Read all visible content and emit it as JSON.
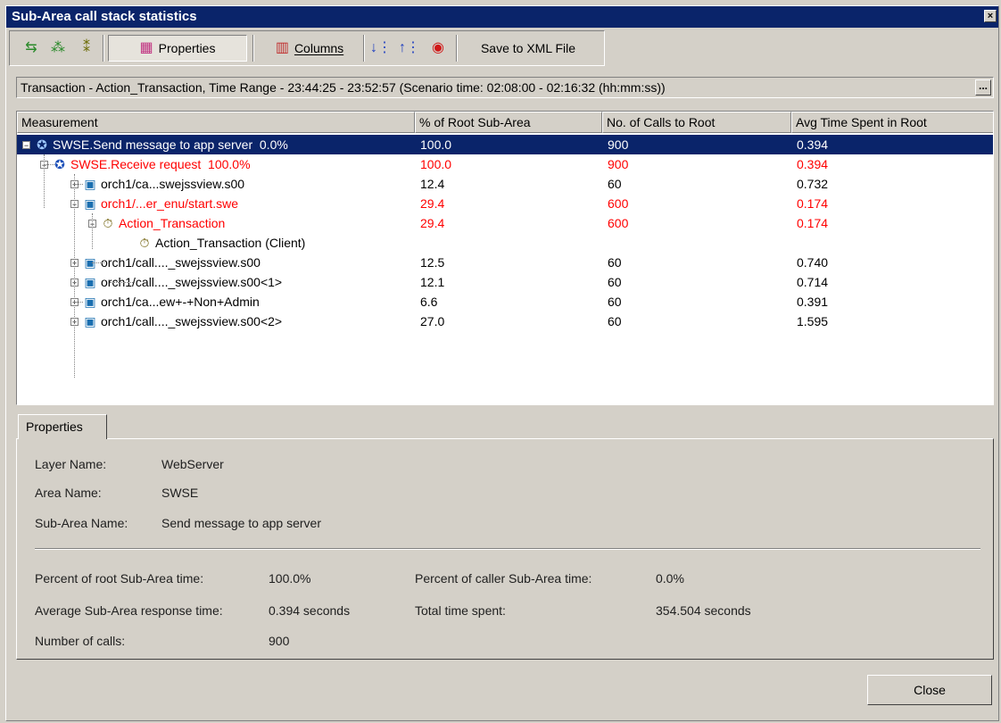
{
  "window": {
    "title": "Sub-Area call stack statistics"
  },
  "toolbar": {
    "properties_label": "Properties",
    "columns_label": "Columns",
    "save_label": "Save to XML File"
  },
  "range_text": "Transaction - Action_Transaction, Time Range - 23:44:25 - 23:52:57 (Scenario time: 02:08:00 - 02:16:32 (hh:mm:ss))",
  "range_button": "...",
  "columns": [
    "Measurement",
    "% of Root Sub-Area",
    "No. of Calls to Root",
    "Avg Time Spent in Root"
  ],
  "rows": [
    {
      "name": "SWSE.Send message to app server  0.0%",
      "pct": "100.0",
      "calls": "900",
      "avg": "0.394",
      "expander": "−",
      "icon": "globe-icon",
      "state": "selected"
    },
    {
      "name": "SWSE.Receive request  100.0%",
      "pct": "100.0",
      "calls": "900",
      "avg": "0.394",
      "expander": "−",
      "icon": "globe-icon",
      "state": "highlighted"
    },
    {
      "name": "orch1/ca...swejssview.s00",
      "pct": "12.4",
      "calls": "60",
      "avg": "0.732",
      "expander": "+",
      "icon": "server-icon",
      "state": "normal"
    },
    {
      "name": "orch1/...er_enu/start.swe",
      "pct": "29.4",
      "calls": "600",
      "avg": "0.174",
      "expander": "−",
      "icon": "server-icon",
      "state": "highlighted"
    },
    {
      "name": "Action_Transaction",
      "pct": "29.4",
      "calls": "600",
      "avg": "0.174",
      "expander": "−",
      "icon": "stopwatch-icon",
      "state": "highlighted"
    },
    {
      "name": "Action_Transaction (Client)",
      "pct": "",
      "calls": "",
      "avg": "",
      "expander": "",
      "icon": "stopwatch-icon",
      "state": "normal"
    },
    {
      "name": "orch1/call...._swejssview.s00",
      "pct": "12.5",
      "calls": "60",
      "avg": "0.740",
      "expander": "+",
      "icon": "server-icon",
      "state": "normal"
    },
    {
      "name": "orch1/call...._swejssview.s00<1>",
      "pct": "12.1",
      "calls": "60",
      "avg": "0.714",
      "expander": "+",
      "icon": "server-icon",
      "state": "normal"
    },
    {
      "name": "orch1/ca...ew+-+Non+Admin",
      "pct": "6.6",
      "calls": "60",
      "avg": "0.391",
      "expander": "+",
      "icon": "server-icon",
      "state": "normal"
    },
    {
      "name": "orch1/call...._swejssview.s00<2>",
      "pct": "27.0",
      "calls": "60",
      "avg": "1.595",
      "expander": "+",
      "icon": "server-icon",
      "state": "normal"
    }
  ],
  "properties": {
    "tab_label": "Properties",
    "layer_label": "Layer Name:",
    "layer_value": "WebServer",
    "area_label": "Area Name:",
    "area_value": "SWSE",
    "subarea_label": "Sub-Area Name:",
    "subarea_value": "Send message to app server",
    "pct_root_label": "Percent of root Sub-Area time:",
    "pct_root_value": "100.0%",
    "pct_caller_label": "Percent of caller Sub-Area time:",
    "pct_caller_value": "0.0%",
    "avg_resp_label": "Average Sub-Area response time:",
    "avg_resp_value": "0.394 seconds",
    "total_label": "Total time spent:",
    "total_value": "354.504 seconds",
    "calls_label": "Number of calls:",
    "calls_value": "900"
  },
  "close_label": "Close",
  "colors": {
    "selection": "#0a246a",
    "highlight_text": "#ff0000",
    "face": "#d4d0c8"
  }
}
